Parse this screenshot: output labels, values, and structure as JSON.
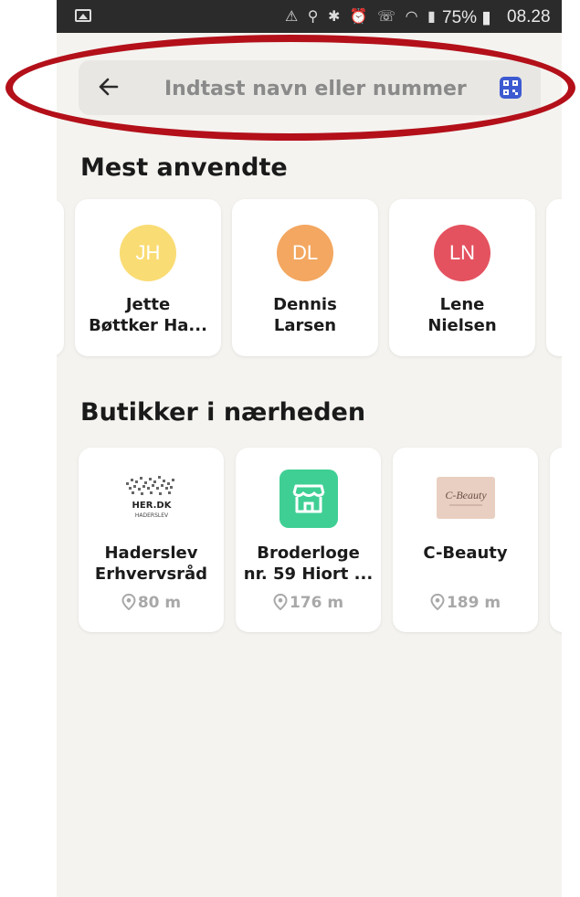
{
  "status_bar": {
    "icons_text": "⚠ ⚲ ✱ ⏰ ☏ ◠ ▮",
    "battery": "75%",
    "time": "08.28"
  },
  "search": {
    "placeholder": "Indtast navn eller nummer",
    "back_icon": "arrow-left-icon",
    "qr_icon": "qr-code-icon",
    "accent": "#3d5ad1"
  },
  "most_used": {
    "title": "Mest anvendte",
    "contacts": [
      {
        "initials": "JH",
        "line1": "Jette",
        "line2": "Bøttker Ha...",
        "color": "#f9dc74"
      },
      {
        "initials": "DL",
        "line1": "Dennis",
        "line2": "Larsen",
        "color": "#f3a760"
      },
      {
        "initials": "LN",
        "line1": "Lene",
        "line2": "Nielsen",
        "color": "#e4525f"
      }
    ]
  },
  "nearby": {
    "title": "Butikker i nærheden",
    "shops": [
      {
        "line1": "Haderslev",
        "line2": "Erhvervsråd",
        "distance": "80 m",
        "logo_text": "HER.DK",
        "logo_sub": "HADERSLEV"
      },
      {
        "line1": "Broderloge",
        "line2": "nr. 59 Hiort ...",
        "distance": "176 m",
        "logo_color": "#3fcf94"
      },
      {
        "line1": "C-Beauty",
        "line2": "",
        "distance": "189 m",
        "logo_text": "C-Beauty",
        "logo_color": "#e9cfc1"
      }
    ]
  },
  "annotation": {
    "color": "#b3101a"
  }
}
